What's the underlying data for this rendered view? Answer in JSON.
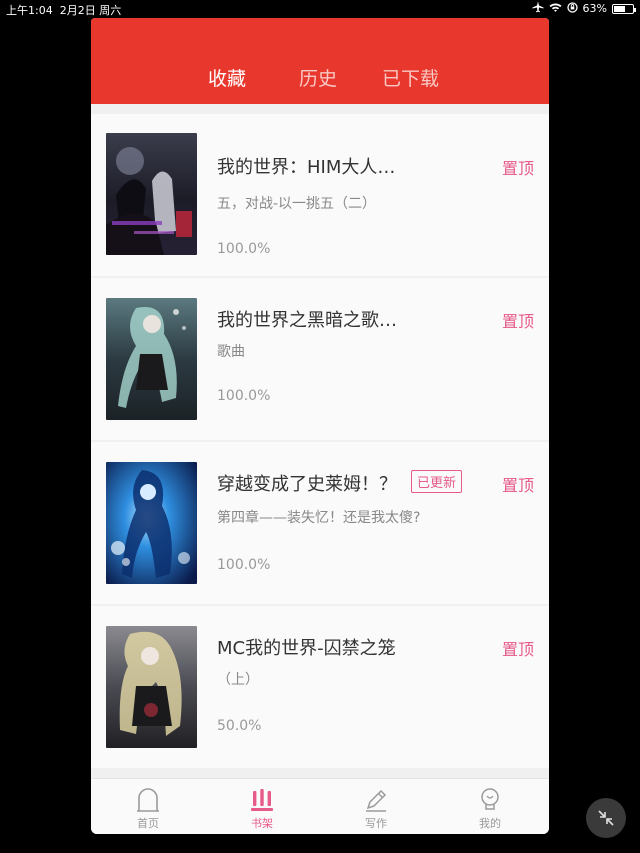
{
  "statusbar": {
    "time": "上午1:04",
    "date": "2月2日 周六",
    "battery": "63%",
    "battery_level": 0.63
  },
  "tabs": [
    "收藏",
    "历史",
    "已下载"
  ],
  "books": [
    {
      "title": "我的世界：HIM大人…",
      "subtitle": "五，对战-以一挑五（二）",
      "progress": "100.0%",
      "pin": "置顶",
      "badge": ""
    },
    {
      "title": "我的世界之黑暗之歌…",
      "subtitle": "歌曲",
      "progress": "100.0%",
      "pin": "置顶",
      "badge": ""
    },
    {
      "title": "穿越变成了史莱姆！？",
      "subtitle": "第四章——装失忆！还是我太傻?",
      "progress": "100.0%",
      "pin": "置顶",
      "badge": "已更新"
    },
    {
      "title": "MC我的世界-囚禁之笼",
      "subtitle": "（上）",
      "progress": "50.0%",
      "pin": "置顶",
      "badge": ""
    }
  ],
  "nav": [
    "首页",
    "书架",
    "写作",
    "我的"
  ],
  "colors": {
    "header": "#e8382d",
    "accent": "#e75a8a"
  }
}
